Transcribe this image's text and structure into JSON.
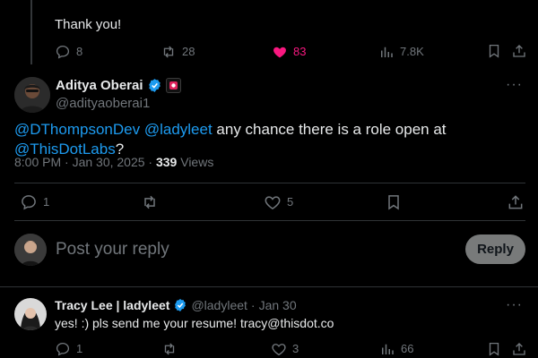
{
  "previous_tweet": {
    "text": "Thank you!",
    "actions": {
      "replies": "8",
      "reposts": "28",
      "likes": "83",
      "views": "7.8K"
    }
  },
  "main_tweet": {
    "author_name": "Aditya Oberai",
    "author_handle": "@adityaoberai1",
    "text_parts": {
      "mention1": "@DThompsonDev",
      "mention2": "@ladyleet",
      "middle": " any chance there is a role open at ",
      "mention3": "@ThisDotLabs",
      "end": "?"
    },
    "time": "8:00 PM · Jan 30, 2025 · ",
    "views_count": "339",
    "views_label": " Views",
    "actions": {
      "replies": "1",
      "likes": "5"
    }
  },
  "composer": {
    "placeholder": "Post your reply",
    "reply_label": "Reply"
  },
  "reply_tweet": {
    "author_name": "Tracy Lee | ladyleet",
    "author_handle": "@ladyleet",
    "dot": "·",
    "time": "Jan 30",
    "text": "yes! :) pls send me your resume! tracy@thisdot.co",
    "actions": {
      "replies": "1",
      "likes": "3",
      "views": "66"
    }
  },
  "colors": {
    "accent": "#1d9bf0",
    "like_active": "#f91880",
    "muted": "#71767b",
    "affiliate_badge": "#e0245e"
  }
}
